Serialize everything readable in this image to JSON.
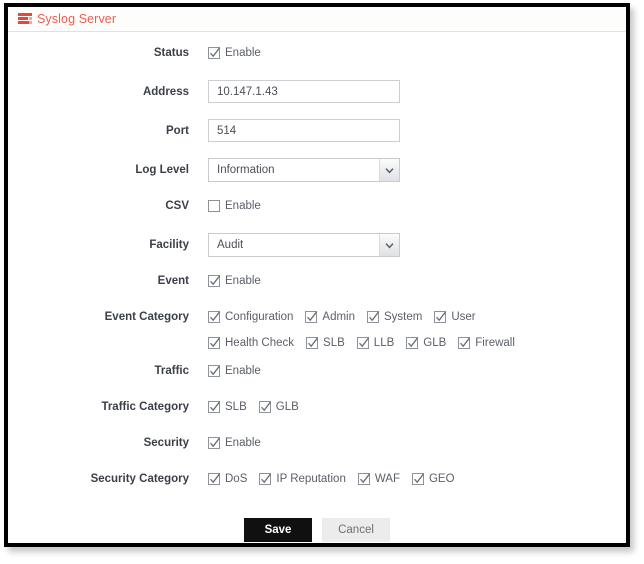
{
  "window": {
    "title": "Syslog Server",
    "icon": "server-log-icon",
    "accent_color": "#ef5d52",
    "divider_color": "#f6d9d2"
  },
  "form": {
    "rows": [
      {
        "label": "Status",
        "type": "checkbox"
      },
      {
        "label": "Address",
        "type": "text"
      },
      {
        "label": "Port",
        "type": "text"
      },
      {
        "label": "Log Level",
        "type": "select"
      },
      {
        "label": "CSV",
        "type": "checkbox"
      },
      {
        "label": "Facility",
        "type": "select"
      },
      {
        "label": "Event",
        "type": "checkbox"
      },
      {
        "label": "Event Category",
        "type": "checkbox-group"
      },
      {
        "label": "Traffic",
        "type": "checkbox"
      },
      {
        "label": "Traffic Category",
        "type": "checkbox-group"
      },
      {
        "label": "Security",
        "type": "checkbox"
      },
      {
        "label": "Security Category",
        "type": "checkbox-group"
      }
    ],
    "status": {
      "label": "Status",
      "enable_label": "Enable",
      "checked": true
    },
    "address": {
      "label": "Address",
      "value": "10.147.1.43",
      "placeholder": ""
    },
    "port": {
      "label": "Port",
      "value": "514",
      "placeholder": ""
    },
    "log_level": {
      "label": "Log Level",
      "value": "Information"
    },
    "csv": {
      "label": "CSV",
      "enable_label": "Enable",
      "checked": false
    },
    "facility": {
      "label": "Facility",
      "value": "Audit"
    },
    "event": {
      "label": "Event",
      "enable_label": "Enable",
      "checked": true
    },
    "event_category": {
      "label": "Event Category",
      "items": [
        {
          "label": "Configuration",
          "checked": true
        },
        {
          "label": "Admin",
          "checked": true
        },
        {
          "label": "System",
          "checked": true
        },
        {
          "label": "User",
          "checked": true
        },
        {
          "label": "Health Check",
          "checked": true
        },
        {
          "label": "SLB",
          "checked": true
        },
        {
          "label": "LLB",
          "checked": true
        },
        {
          "label": "GLB",
          "checked": true
        },
        {
          "label": "Firewall",
          "checked": true
        }
      ]
    },
    "traffic": {
      "label": "Traffic",
      "enable_label": "Enable",
      "checked": true
    },
    "traffic_category": {
      "label": "Traffic Category",
      "items": [
        {
          "label": "SLB",
          "checked": true
        },
        {
          "label": "GLB",
          "checked": true
        }
      ]
    },
    "security": {
      "label": "Security",
      "enable_label": "Enable",
      "checked": true
    },
    "security_category": {
      "label": "Security Category",
      "items": [
        {
          "label": "DoS",
          "checked": true
        },
        {
          "label": "IP Reputation",
          "checked": true
        },
        {
          "label": "WAF",
          "checked": true
        },
        {
          "label": "GEO",
          "checked": true
        }
      ]
    }
  },
  "buttons": {
    "save_label": "Save",
    "cancel_label": "Cancel",
    "save_bg": "#101010",
    "cancel_bg": "#ececec"
  }
}
